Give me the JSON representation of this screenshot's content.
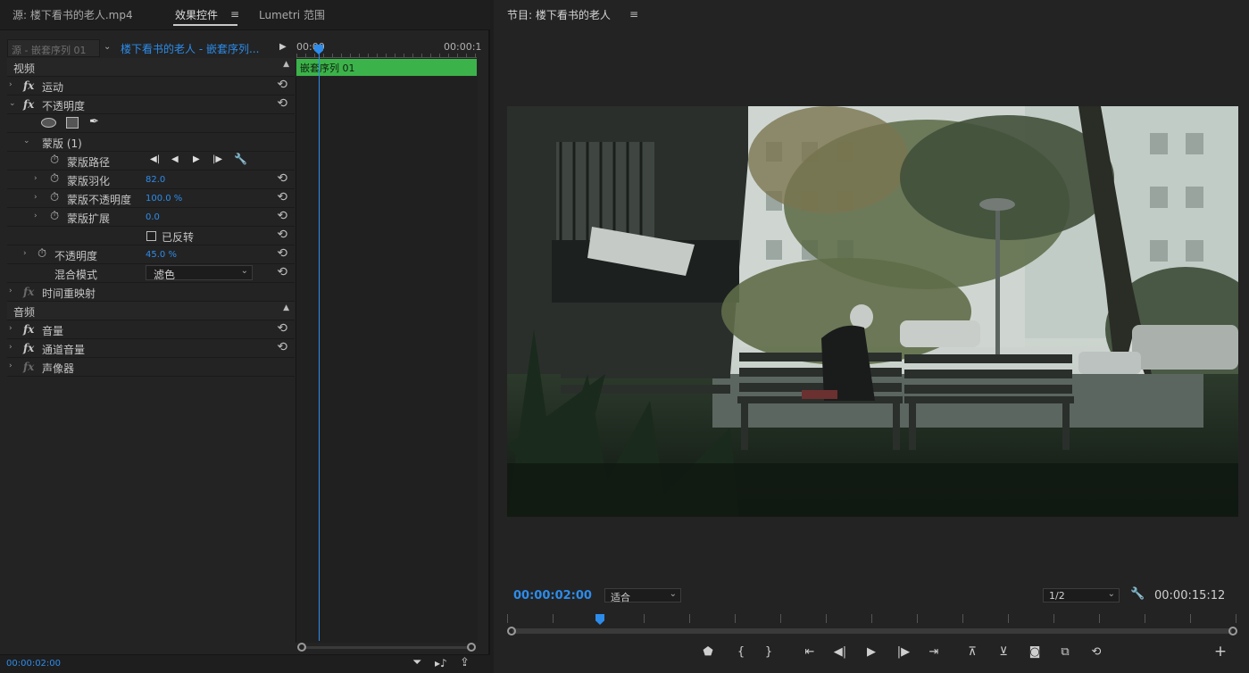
{
  "left_panel": {
    "tabs": [
      {
        "label": "源: 楼下看书的老人.mp4"
      },
      {
        "label": "效果控件"
      },
      {
        "label": "Lumetri 范围"
      }
    ],
    "header": {
      "source_label": "源 - 嵌套序列 01",
      "clip_label": "楼下看书的老人 - 嵌套序列...",
      "tc_start": "00:00",
      "tc_end": "00:00:1"
    },
    "clip_bar_label": "嵌套序列 01",
    "video_section": "视频",
    "effects": {
      "motion": "运动",
      "opacity": "不透明度",
      "mask": "蒙版 (1)",
      "mask_path": "蒙版路径",
      "mask_feather": {
        "label": "蒙版羽化",
        "value": "82.0"
      },
      "mask_opacity": {
        "label": "蒙版不透明度",
        "value": "100.0 %"
      },
      "mask_expansion": {
        "label": "蒙版扩展",
        "value": "0.0"
      },
      "inverted": "已反转",
      "opacity_prop": {
        "label": "不透明度",
        "value": "45.0 %"
      },
      "blend_mode": {
        "label": "混合模式",
        "value": "滤色"
      },
      "time_remap": "时间重映射"
    },
    "audio_section": "音频",
    "audio_effects": {
      "volume": "音量",
      "channel_volume": "通道音量",
      "panner": "声像器"
    },
    "footer_timecode": "00:00:02:00"
  },
  "program_monitor": {
    "title": "节目: 楼下看书的老人",
    "playhead_timecode": "00:00:02:00",
    "zoom": "适合",
    "resolution": "1/2",
    "duration": "00:00:15:12"
  },
  "colors": {
    "accent": "#2d8ceb",
    "clip_green": "#3cb34a",
    "panel_bg": "#232323"
  }
}
